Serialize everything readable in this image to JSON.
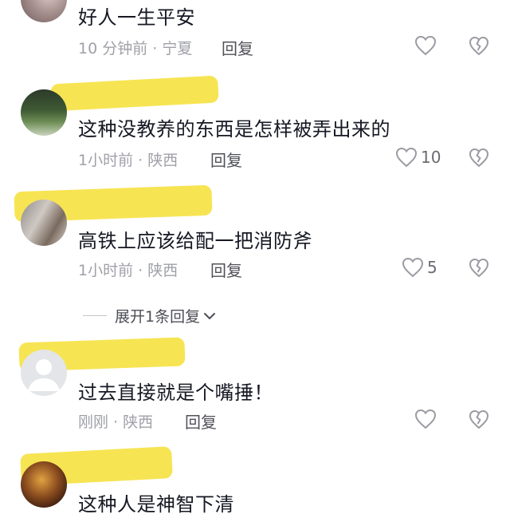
{
  "comments": [
    {
      "username": "",
      "text": "好人一生平安",
      "time": "10 分钟前",
      "location": "宁夏",
      "reply_label": "回复",
      "likes": "",
      "avatar": "photo"
    },
    {
      "username": "",
      "text": "这种没教养的东西是怎样被弄出来的",
      "time": "1小时前",
      "location": "陕西",
      "reply_label": "回复",
      "likes": "10",
      "avatar": "photo"
    },
    {
      "username": "",
      "text": "高铁上应该给配一把消防斧",
      "time": "1小时前",
      "location": "陕西",
      "reply_label": "回复",
      "likes": "5",
      "avatar": "photo"
    },
    {
      "username": "",
      "text": "过去直接就是个嘴捶！",
      "time": "刚刚",
      "location": "陕西",
      "reply_label": "回复",
      "likes": "",
      "avatar": "default"
    },
    {
      "username": "",
      "text": "这种人是神智下清",
      "time": "",
      "location": "",
      "reply_label": "",
      "likes": "",
      "avatar": "photo"
    }
  ],
  "expand_replies": {
    "label": "展开1条回复"
  },
  "separator": "·",
  "icons": {
    "like": "heart-outline-icon",
    "dislike": "broken-heart-icon",
    "expand": "chevron-down-icon"
  },
  "colors": {
    "text": "#161823",
    "meta": "#a0a1a8",
    "highlight": "#f7e34a"
  }
}
